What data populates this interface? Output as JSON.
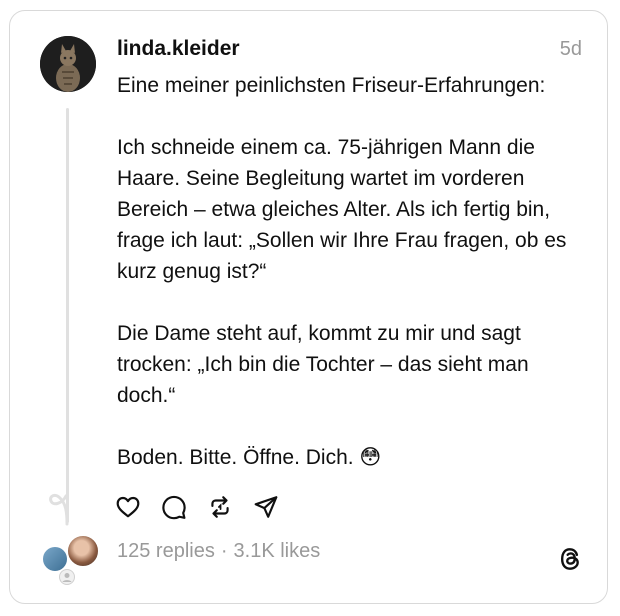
{
  "post": {
    "username": "linda.kleider",
    "time": "5d",
    "text": "Eine meiner peinlichsten Friseur-Erfahrungen:\n\nIch schneide einem ca. 75-jährigen Mann die Haare. Seine Begleitung wartet im vorderen Bereich – etwa gleiches Alter. Als ich fertig bin, frage ich laut: „Sollen wir Ihre Frau fragen, ob es kurz genug ist?“\n\nDie Dame steht auf, kommt zu mir und sagt trocken: „Ich bin die Tochter – das sieht man doch.“\n\nBoden. Bitte. Öffne. Dich. 😳"
  },
  "footer": {
    "replies": "125 replies",
    "separator": "·",
    "likes": "3.1K likes"
  },
  "icons": {
    "like": "heart-icon",
    "reply": "comment-icon",
    "repost": "repost-icon",
    "share": "send-icon",
    "app": "threads-logo-icon"
  },
  "colors": {
    "text": "#101010",
    "muted": "#999999",
    "border": "#d9d9d9"
  }
}
